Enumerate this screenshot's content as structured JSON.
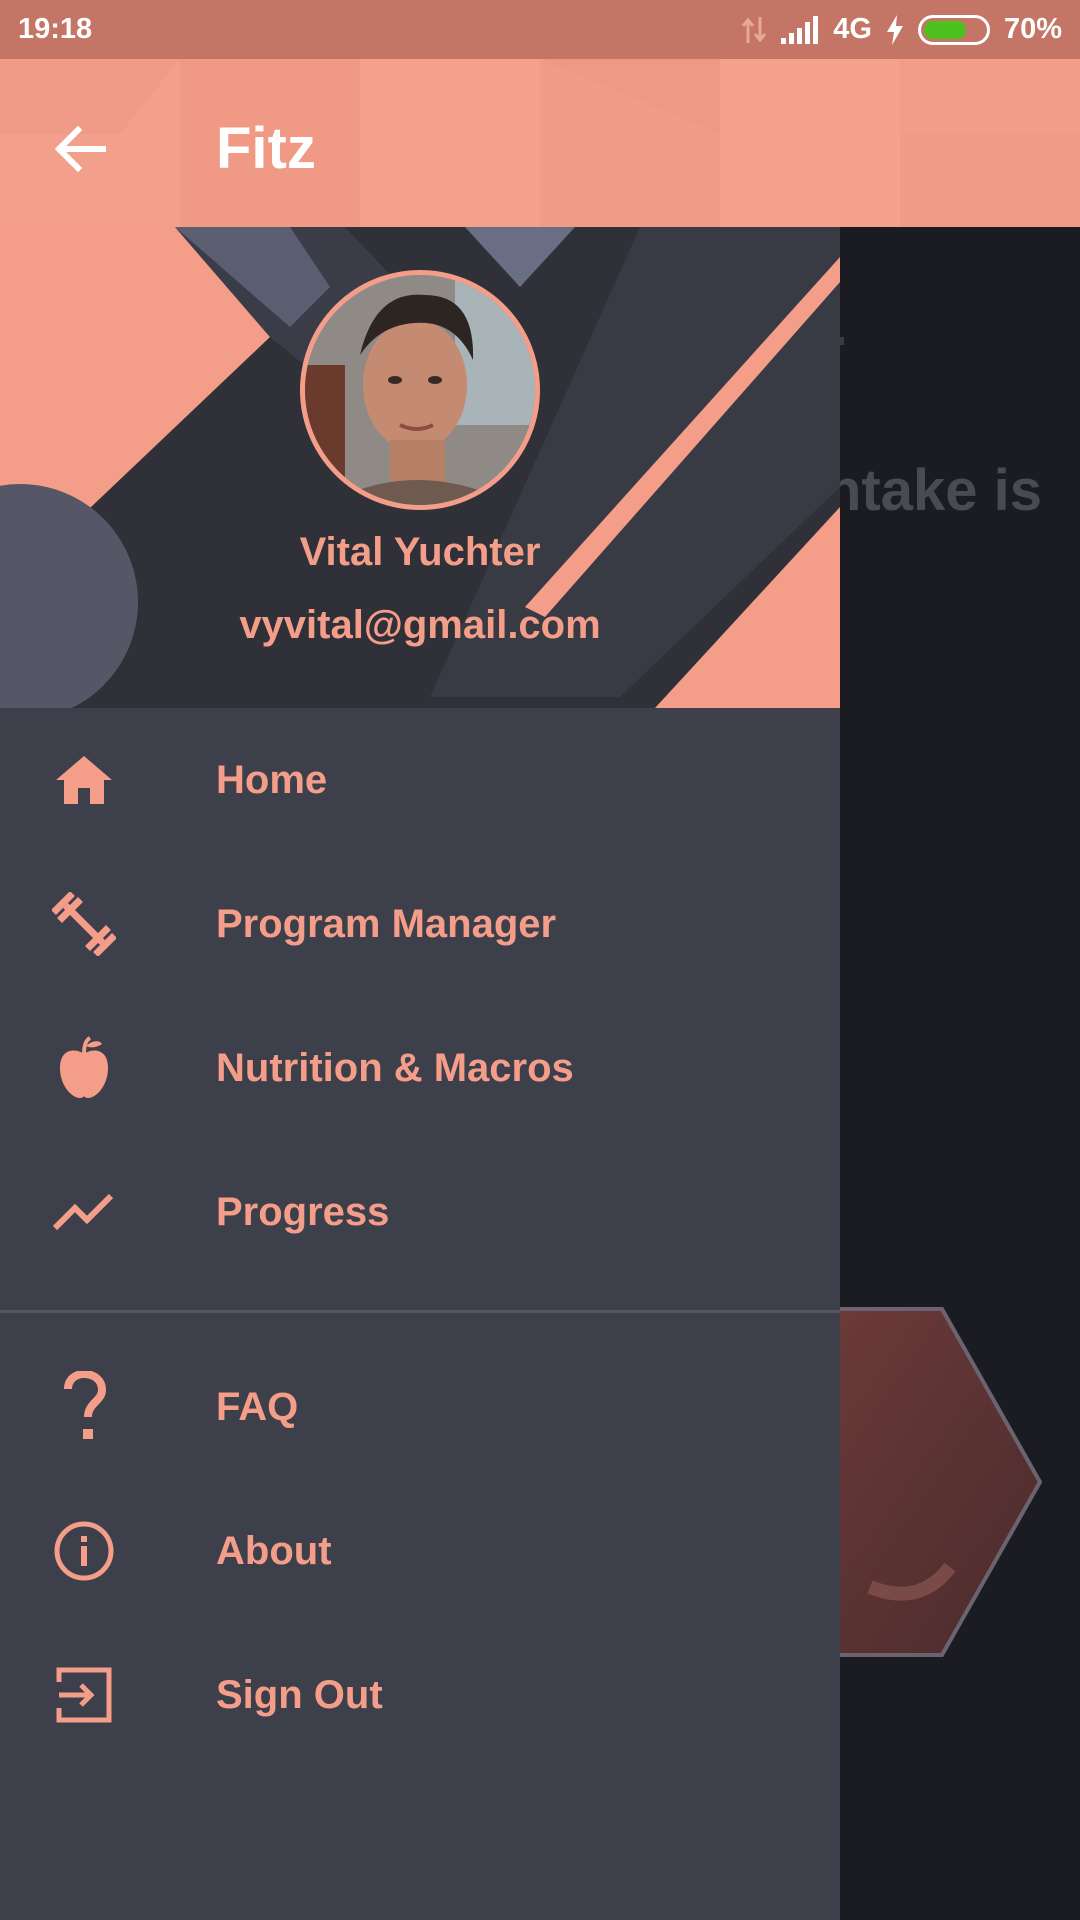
{
  "status_bar": {
    "time": "19:18",
    "network": "4G",
    "battery_percent": "70%",
    "battery_level": 0.7,
    "icons": [
      "data-transfer-icon",
      "signal-icon",
      "charging-icon",
      "battery-icon"
    ]
  },
  "app_bar": {
    "title": "Fitz",
    "back_icon": "arrow-back-icon"
  },
  "drawer": {
    "user": {
      "name": "Vital Yuchter",
      "email": "vyvital@gmail.com"
    },
    "primary_items": [
      {
        "label": "Home",
        "icon": "home-icon"
      },
      {
        "label": "Program Manager",
        "icon": "dumbbell-icon"
      },
      {
        "label": "Nutrition & Macros",
        "icon": "apple-icon"
      },
      {
        "label": "Progress",
        "icon": "trending-up-icon"
      }
    ],
    "secondary_items": [
      {
        "label": "FAQ",
        "icon": "question-icon"
      },
      {
        "label": "About",
        "icon": "info-icon"
      },
      {
        "label": "Sign Out",
        "icon": "sign-out-icon"
      }
    ]
  },
  "background": {
    "partial_text": "ntake is"
  },
  "colors": {
    "accent": "#f49e8a",
    "status_bar": "#c47565",
    "drawer_bg": "#3d3f4a",
    "scrim_bg": "#1b1c21"
  }
}
